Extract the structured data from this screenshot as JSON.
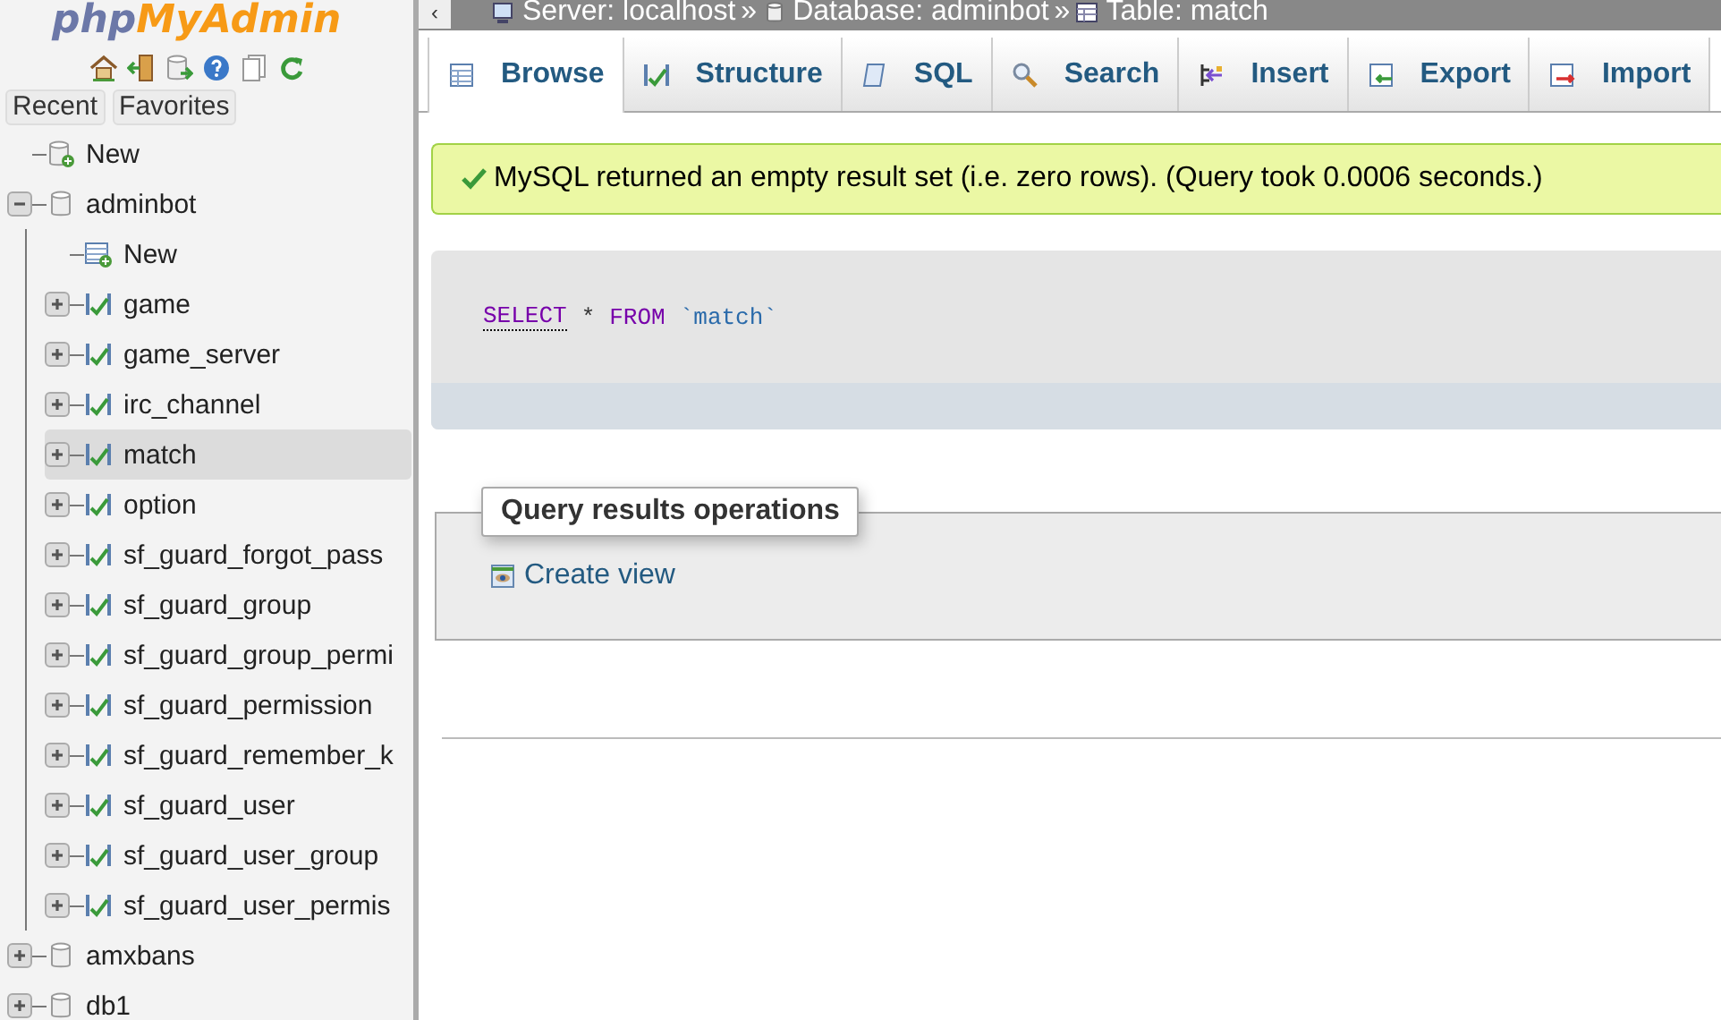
{
  "logo": {
    "prefix": "php",
    "name": "MyAdmin"
  },
  "nav_icons": [
    {
      "kind": "home"
    },
    {
      "kind": "exit"
    },
    {
      "kind": "db-go"
    },
    {
      "kind": "help"
    },
    {
      "kind": "docs"
    },
    {
      "kind": "reload"
    }
  ],
  "nav_tabs": [
    {
      "label": "Recent"
    },
    {
      "label": "Favorites"
    }
  ],
  "tree": [
    {
      "label": "New",
      "kind": "new-db",
      "selected": false
    },
    {
      "label": "adminbot",
      "kind": "db",
      "selected": false,
      "expanded": true,
      "children": [
        {
          "label": "New",
          "kind": "new-table",
          "selected": false
        },
        {
          "label": "game",
          "kind": "table",
          "selected": false,
          "expanded": false
        },
        {
          "label": "game_server",
          "kind": "table",
          "selected": false,
          "expanded": false
        },
        {
          "label": "irc_channel",
          "kind": "table",
          "selected": false,
          "expanded": false
        },
        {
          "label": "match",
          "kind": "table",
          "selected": true,
          "expanded": false
        },
        {
          "label": "option",
          "kind": "table",
          "selected": false,
          "expanded": false
        },
        {
          "label": "sf_guard_forgot_pass",
          "kind": "table",
          "selected": false,
          "expanded": false
        },
        {
          "label": "sf_guard_group",
          "kind": "table",
          "selected": false,
          "expanded": false
        },
        {
          "label": "sf_guard_group_permi",
          "kind": "table",
          "selected": false,
          "expanded": false
        },
        {
          "label": "sf_guard_permission",
          "kind": "table",
          "selected": false,
          "expanded": false
        },
        {
          "label": "sf_guard_remember_k",
          "kind": "table",
          "selected": false,
          "expanded": false
        },
        {
          "label": "sf_guard_user",
          "kind": "table",
          "selected": false,
          "expanded": false
        },
        {
          "label": "sf_guard_user_group",
          "kind": "table",
          "selected": false,
          "expanded": false
        },
        {
          "label": "sf_guard_user_permis",
          "kind": "table",
          "selected": false,
          "expanded": false
        }
      ]
    },
    {
      "label": "amxbans",
      "kind": "db",
      "selected": false,
      "expanded": false
    },
    {
      "label": "db1",
      "kind": "db",
      "selected": false,
      "expanded": false
    }
  ],
  "collapse_button": "‹",
  "breadcrumb": [
    {
      "label": "Server: localhost",
      "kind": "server",
      "separator": "»"
    },
    {
      "label": "Database: adminbot",
      "kind": "db",
      "separator": "»"
    },
    {
      "label": "Table: match",
      "kind": "table"
    }
  ],
  "tabs": [
    {
      "label": "Browse",
      "kind": "browse",
      "selected": true
    },
    {
      "label": "Structure",
      "kind": "structure",
      "selected": false
    },
    {
      "label": "SQL",
      "kind": "sql",
      "selected": false
    },
    {
      "label": "Search",
      "kind": "search",
      "selected": false
    },
    {
      "label": "Insert",
      "kind": "insert",
      "selected": false
    },
    {
      "label": "Export",
      "kind": "export",
      "selected": false
    },
    {
      "label": "Import",
      "kind": "import",
      "selected": false
    }
  ],
  "message": {
    "kind": "success",
    "text": "MySQL returned an empty result set (i.e. zero rows). (Query took 0.0006 seconds.)"
  },
  "query": [
    {
      "text": "SELECT",
      "kind": "keyword-link"
    },
    {
      "text": "*",
      "kind": "operator"
    },
    {
      "text": "FROM",
      "kind": "keyword"
    },
    {
      "text": "`match`",
      "kind": "identifier"
    }
  ],
  "operations": {
    "title": "Query results operations",
    "links": [
      {
        "label": "Create view"
      }
    ]
  }
}
